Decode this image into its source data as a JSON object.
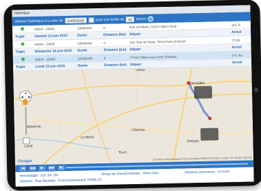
{
  "window": {
    "title": "Historique"
  },
  "toolbar": {
    "label_show": "Afficher l'historique à la date du",
    "date_value": "01/06/2015",
    "label_duration": "pour une durée de",
    "duration_value": "40",
    "label_unit": "jour(s)",
    "help_icon": "?"
  },
  "rows": [
    {
      "kind": "data",
      "start": "00h00 - 23h59",
      "duration": "23h59m59",
      "distance": "0",
      "address": "Rue d'Orléans, 92210 Saint Cloud",
      "extra": "116, R"
    },
    {
      "kind": "header",
      "c0": "Trajet",
      "c1": "Samedi 13 juin 2015",
      "c2": "Durée",
      "c3": "Distance (km)",
      "c4": "Départ",
      "c5": "Arrivé"
    },
    {
      "kind": "data",
      "start": "00h00 - 23h59",
      "duration": "23h59m59",
      "distance": "0",
      "address": "116, Rue de Patay, 75013 Paris (France)",
      "extra": "77181"
    },
    {
      "kind": "header",
      "c0": "Trajet",
      "c1": "Dimanche 14 juin 2015",
      "c2": "Durée",
      "c3": "Distance (km)",
      "c4": "Départ",
      "c5": "Arrivé"
    },
    {
      "kind": "data",
      "selected": true,
      "start": "00h00 - 23h59",
      "duration": "23h59m59",
      "distance": "0",
      "address": "77760 Villiers-sous-Grez (France)",
      "extra": "2-4, Ru"
    },
    {
      "kind": "header",
      "c0": "Trajet",
      "c1": "Lundi 15 juin 2015",
      "c2": "Durée",
      "c3": "Distance (km)",
      "c4": "Départ",
      "c5": "Arrivé"
    }
  ],
  "map": {
    "labels": {
      "dreux": "Dreux",
      "versailles": "Versailles",
      "mayenne": "Mayenne",
      "le_mans": "Le Mans",
      "chartres": "Chartres",
      "orleans": "Orléans",
      "tours": "Tours",
      "laval": "Laval"
    },
    "google": "Google",
    "attribution": "Données cartographiques ©2015 GeoBasis-DE/BKG (©2009), Google, Inst. Geogr. Nacional",
    "colors": {
      "land": "#ece7dd",
      "route": "#7b8fd6",
      "road": "#f6d37a"
    }
  },
  "player": {
    "buttons": [
      "|◀",
      "◀◀",
      "▶",
      "▶▶",
      "▶|"
    ]
  },
  "footer": {
    "horodatage": "Horodatage : 21h 3m 19s",
    "temps": "Temps de fonctionnement : 0min 0sec",
    "distance": "Distance parcourue : 0.0 kms",
    "adresse": "Adresse : Rue Michelet, 7e Arrondissement 75006 (fr)"
  }
}
